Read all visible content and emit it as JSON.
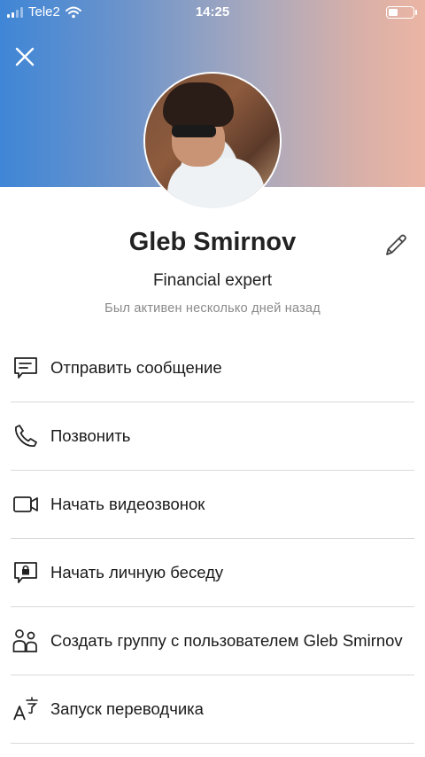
{
  "status_bar": {
    "carrier": "Tele2",
    "time": "14:25",
    "battery_level": 0.4
  },
  "profile": {
    "name": "Gleb Smirnov",
    "subtitle": "Financial expert",
    "status": "Был активен несколько дней назад"
  },
  "actions": [
    {
      "label": "Отправить сообщение",
      "icon": "message-icon"
    },
    {
      "label": "Позвонить",
      "icon": "phone-icon"
    },
    {
      "label": "Начать видеозвонок",
      "icon": "video-icon"
    },
    {
      "label": "Начать личную беседу",
      "icon": "private-chat-icon"
    },
    {
      "label": "Создать группу с пользователем Gleb Smirnov",
      "icon": "group-icon"
    },
    {
      "label": "Запуск переводчика",
      "icon": "translate-icon"
    }
  ],
  "colors": {
    "header_gradient_start": "#3f86d6",
    "header_gradient_end": "#ebb5a4",
    "divider": "#d9d9d9",
    "muted_text": "#8a8a8a"
  }
}
